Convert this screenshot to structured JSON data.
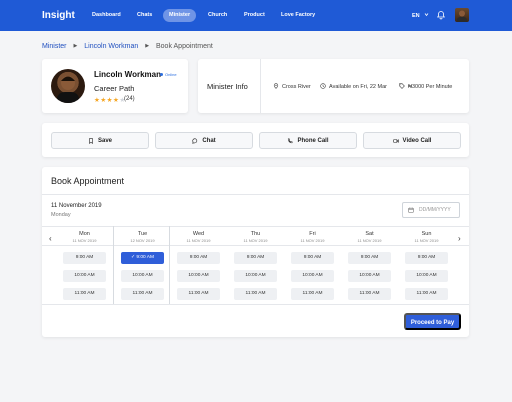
{
  "nav": {
    "brand": "Insight",
    "links": [
      {
        "label": "Dashboard"
      },
      {
        "label": "Chats"
      },
      {
        "label": "Minister",
        "active": true
      },
      {
        "label": "Church"
      },
      {
        "label": "Product"
      },
      {
        "label": "Love Factory"
      }
    ],
    "language": "EN",
    "icons": {
      "bell": "bell-icon",
      "language_toggle": "chevron-down-icon"
    }
  },
  "breadcrumb": [
    "Minister",
    "Lincoln Workman",
    "Book Appointment"
  ],
  "profile": {
    "name": "Lincoln Workman",
    "status": "Online",
    "title": "Career Path",
    "rating": 4,
    "rating_max": 5,
    "review_count": "(24)"
  },
  "info": {
    "title": "Minister Info",
    "location": "Cross River",
    "availability": "Available on Fri, 22 Mar",
    "price": "₦3000 Per Minute"
  },
  "actions": [
    {
      "label": "Save",
      "icon": "bookmark-icon"
    },
    {
      "label": "Chat",
      "icon": "chat-icon"
    },
    {
      "label": "Phone Call",
      "icon": "phone-icon"
    },
    {
      "label": "Video Call",
      "icon": "video-icon"
    }
  ],
  "booking": {
    "title": "Book Appointment",
    "selected_date": "11 November 2019",
    "selected_day": "Monday",
    "date_placeholder": "DD/MM/YYYY",
    "days": [
      {
        "name": "Mon",
        "date": "11 NOV 2019"
      },
      {
        "name": "Tue",
        "date": "12 NOV 2019"
      },
      {
        "name": "Wed",
        "date": "11 NOV 2019"
      },
      {
        "name": "Thu",
        "date": "11 NOV 2019"
      },
      {
        "name": "Fri",
        "date": "11 NOV 2019"
      },
      {
        "name": "Sat",
        "date": "11 NOV 2019"
      },
      {
        "name": "Sun",
        "date": "11 NOV 2019"
      }
    ],
    "times": [
      "9:00 AM",
      "10:00 AM",
      "11:00 AM"
    ],
    "selected_slot_time": "9:00 AM",
    "selected_slot_day": "Tue",
    "proceed_label": "Proceed to Pay"
  },
  "colors": {
    "primary": "#1f5ad6",
    "button": "#2f5ed9",
    "star": "#f5a623"
  }
}
